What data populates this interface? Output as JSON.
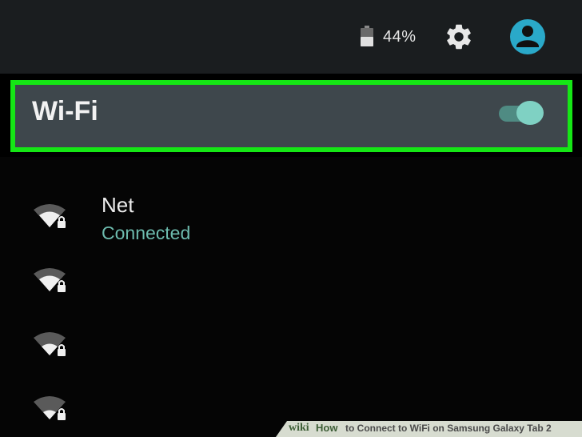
{
  "status_bar": {
    "battery_percent": "44%",
    "battery_level": 0.44,
    "icons": [
      "battery-icon",
      "gear-icon",
      "account-icon"
    ]
  },
  "wifi": {
    "title": "Wi-Fi",
    "enabled": true
  },
  "networks": [
    {
      "name": "Net",
      "status": "Connected",
      "secured": true
    },
    {
      "name": "",
      "status": "",
      "secured": true
    },
    {
      "name": "",
      "status": "",
      "secured": true
    },
    {
      "name": "",
      "status": "",
      "secured": true
    }
  ],
  "banner": {
    "wiki": "wiki",
    "how": "How",
    "title": "to Connect to WiFi on Samsung Galaxy Tab 2"
  },
  "colors": {
    "highlight": "#15e615",
    "accent": "#7fd1c3",
    "status_text": "#6dbbae",
    "row_bg": "#3e474c"
  }
}
